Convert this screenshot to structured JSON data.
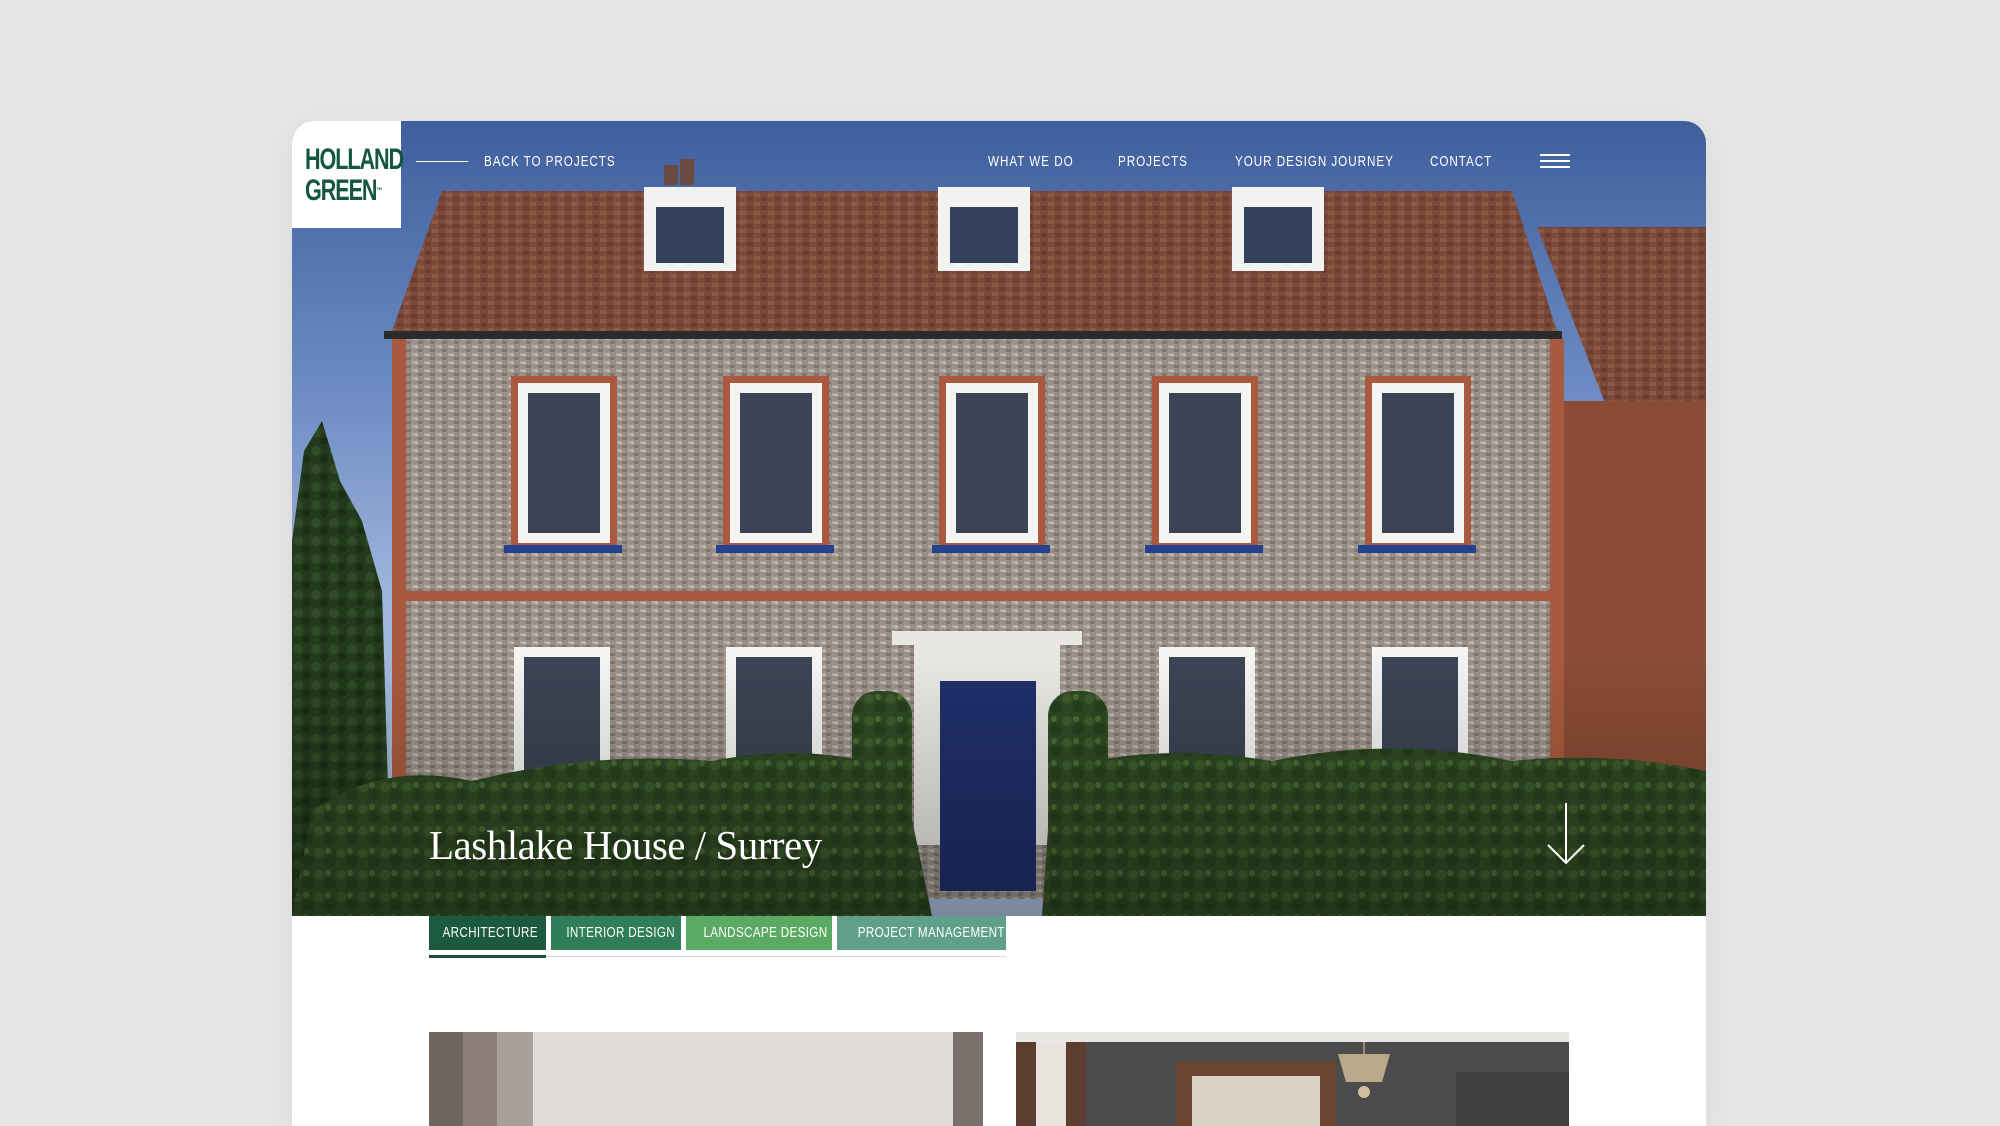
{
  "logo": {
    "line1": "HOLLAND",
    "line2": "GREEN",
    "tm": "™"
  },
  "topbar": {
    "back_label": "BACK TO PROJECTS",
    "nav": [
      {
        "label": "WHAT WE DO"
      },
      {
        "label": "PROJECTS"
      },
      {
        "label": "YOUR DESIGN JOURNEY"
      },
      {
        "label": "CONTACT"
      }
    ]
  },
  "hero": {
    "title": "Lashlake House / Surrey"
  },
  "tabs": [
    {
      "label": "ARCHITECTURE",
      "color": "#1b5a3f",
      "active": true
    },
    {
      "label": "INTERIOR DESIGN",
      "color": "#2f7e57",
      "active": false
    },
    {
      "label": "LANDSCAPE DESIGN",
      "color": "#5aaa63",
      "active": false
    },
    {
      "label": "PROJECT MANAGEMENT",
      "color": "#5f9f8c",
      "active": false
    }
  ],
  "colors": {
    "brand_green": "#15573e",
    "background": "#e6e6e7"
  }
}
